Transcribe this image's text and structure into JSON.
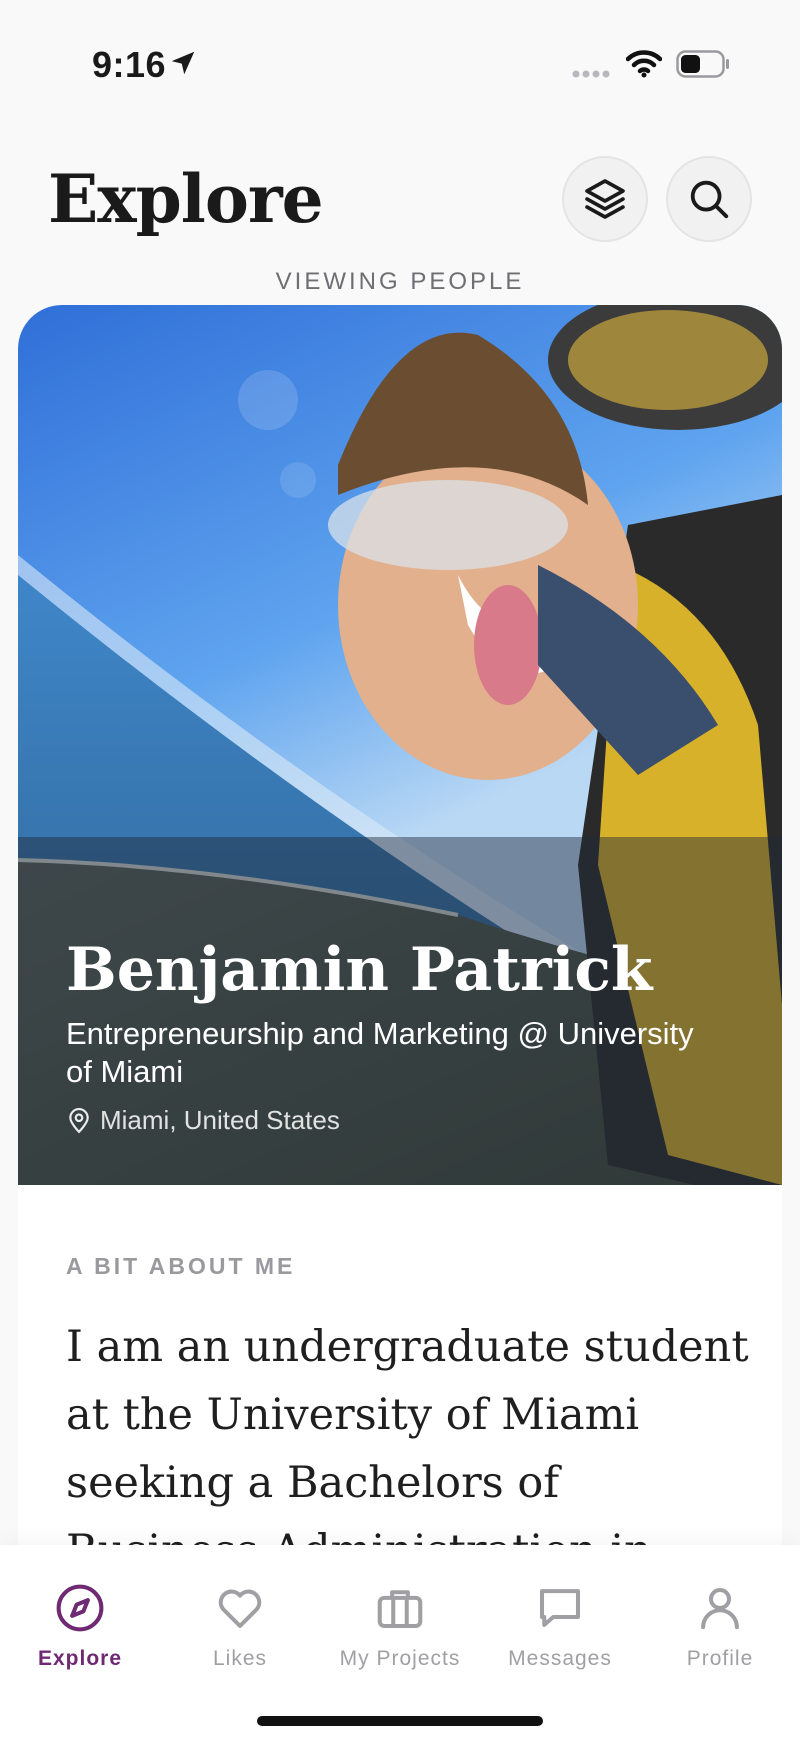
{
  "status_bar": {
    "time": "9:16"
  },
  "header": {
    "title": "Explore",
    "viewing_label": "VIEWING PEOPLE"
  },
  "profile": {
    "name": "Benjamin Patrick",
    "tagline": "Entrepreneurship and Marketing @ University of Miami",
    "location": "Miami, United States",
    "about_heading": "A BIT ABOUT ME",
    "about_text": "I am an undergraduate student at the University of Miami seeking a Bachelors of Business Administration in"
  },
  "tabs": [
    {
      "label": "Explore",
      "icon": "compass-icon",
      "active": true
    },
    {
      "label": "Likes",
      "icon": "heart-icon",
      "active": false
    },
    {
      "label": "My Projects",
      "icon": "briefcase-icon",
      "active": false
    },
    {
      "label": "Messages",
      "icon": "chat-bubble-icon",
      "active": false
    },
    {
      "label": "Profile",
      "icon": "person-icon",
      "active": false
    }
  ],
  "colors": {
    "accent": "#6f2a73",
    "inactive": "#a0a0a4",
    "background": "#f9f9fa"
  }
}
